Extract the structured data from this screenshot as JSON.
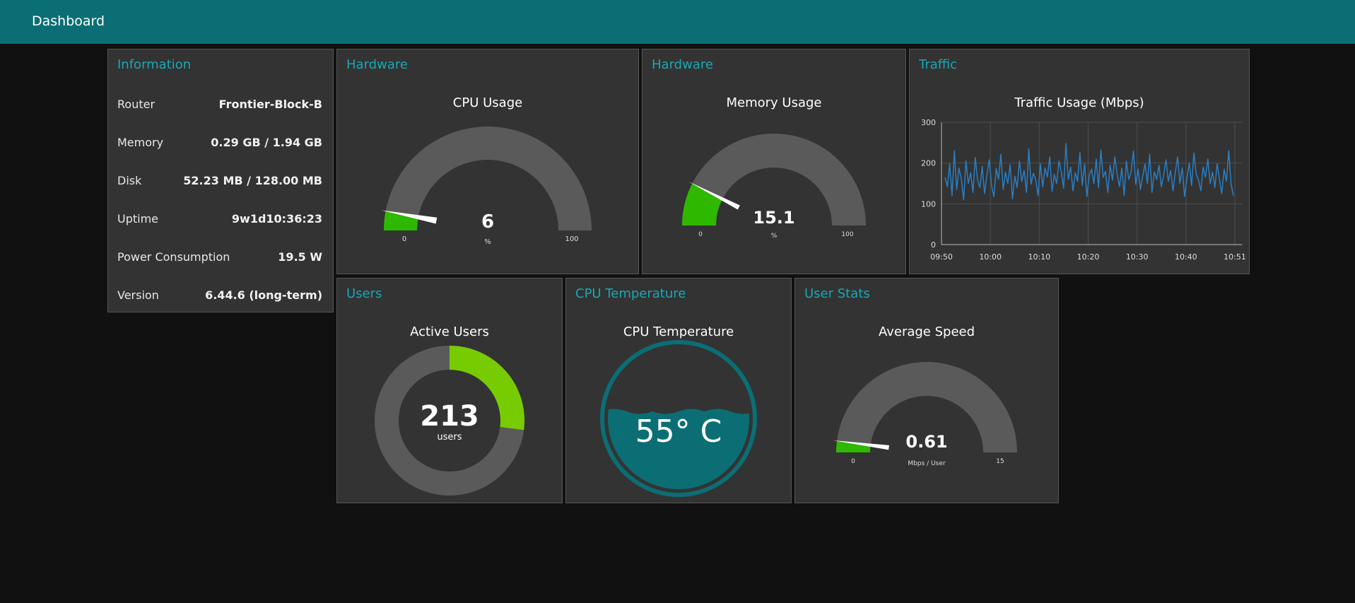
{
  "header": {
    "title": "Dashboard"
  },
  "colors": {
    "header_bg": "#0b6e75",
    "card_title": "#17a9b5",
    "gauge_fill": "#2fb800",
    "gauge_track": "#5a5a5a",
    "donut_fill": "#76cc00",
    "temperature": "#0b6e75",
    "traffic_line": "#2a7ec4"
  },
  "information": {
    "title": "Information",
    "rows": [
      {
        "label": "Router",
        "value": "Frontier-Block-B"
      },
      {
        "label": "Memory",
        "value": "0.29 GB / 1.94 GB"
      },
      {
        "label": "Disk",
        "value": "52.23 MB / 128.00 MB"
      },
      {
        "label": "Uptime",
        "value": "9w1d10:36:23"
      },
      {
        "label": "Power Consumption",
        "value": "19.5 W"
      },
      {
        "label": "Version",
        "value": "6.44.6 (long-term)"
      }
    ]
  },
  "cpu": {
    "card_title": "Hardware",
    "title": "CPU Usage",
    "value": 6,
    "value_text": "6",
    "unit": "%",
    "min": 0,
    "max": 100,
    "min_label": "0",
    "max_label": "100"
  },
  "memory": {
    "card_title": "Hardware",
    "title": "Memory Usage",
    "value": 15.1,
    "value_text": "15.1",
    "unit": "%",
    "min": 0,
    "max": 100,
    "min_label": "0",
    "max_label": "100"
  },
  "traffic": {
    "card_title": "Traffic",
    "title": "Traffic Usage (Mbps)"
  },
  "users": {
    "card_title": "Users",
    "title": "Active Users",
    "value": 213,
    "value_text": "213",
    "unit": "users",
    "fill_fraction": 0.27
  },
  "cpu_temp": {
    "card_title": "CPU Temperature",
    "title": "CPU Temperature",
    "value_text": "55° C",
    "level_fraction": 0.55
  },
  "user_stats": {
    "card_title": "User Stats",
    "title": "Average Speed",
    "value": 0.61,
    "value_text": "0.61",
    "unit": "Mbps / User",
    "min": 0,
    "max": 15,
    "min_label": "0",
    "max_label": "15"
  },
  "chart_data": {
    "type": "line",
    "title": "Traffic Usage (Mbps)",
    "xlabel": "",
    "ylabel": "",
    "ylim": [
      0,
      300
    ],
    "yticks": [
      0,
      100,
      200,
      300
    ],
    "xticks": [
      "09:50",
      "10:00",
      "10:10",
      "10:20",
      "10:30",
      "10:40",
      "10:51"
    ],
    "grid": true,
    "series": [
      {
        "values": [
          165,
          142,
          198,
          120,
          230,
          135,
          188,
          162,
          110,
          205,
          150,
          176,
          128,
          214,
          158,
          140,
          192,
          125,
          170,
          208,
          145,
          118,
          187,
          160,
          222,
          135,
          178,
          150,
          196,
          112,
          168,
          140,
          205,
          155,
          182,
          128,
          235,
          148,
          175,
          160,
          120,
          198,
          142,
          188,
          166,
          215,
          130,
          172,
          150,
          205,
          178,
          138,
          248,
          160,
          190,
          132,
          176,
          155,
          226,
          145,
          198,
          118,
          170,
          185,
          150,
          210,
          140,
          232,
          165,
          180,
          128,
          195,
          158,
          215,
          172,
          142,
          188,
          120,
          205,
          160,
          176,
          230,
          148,
          185,
          135,
          168,
          198,
          150,
          222,
          128,
          178,
          160,
          195,
          142,
          170,
          208,
          155,
          182,
          132,
          176,
          215,
          150,
          188,
          118,
          162,
          200,
          145,
          225,
          172,
          158,
          132,
          190,
          165,
          210,
          150,
          178,
          140,
          198,
          160,
          125,
          185,
          155,
          230,
          148,
          120
        ]
      }
    ]
  }
}
